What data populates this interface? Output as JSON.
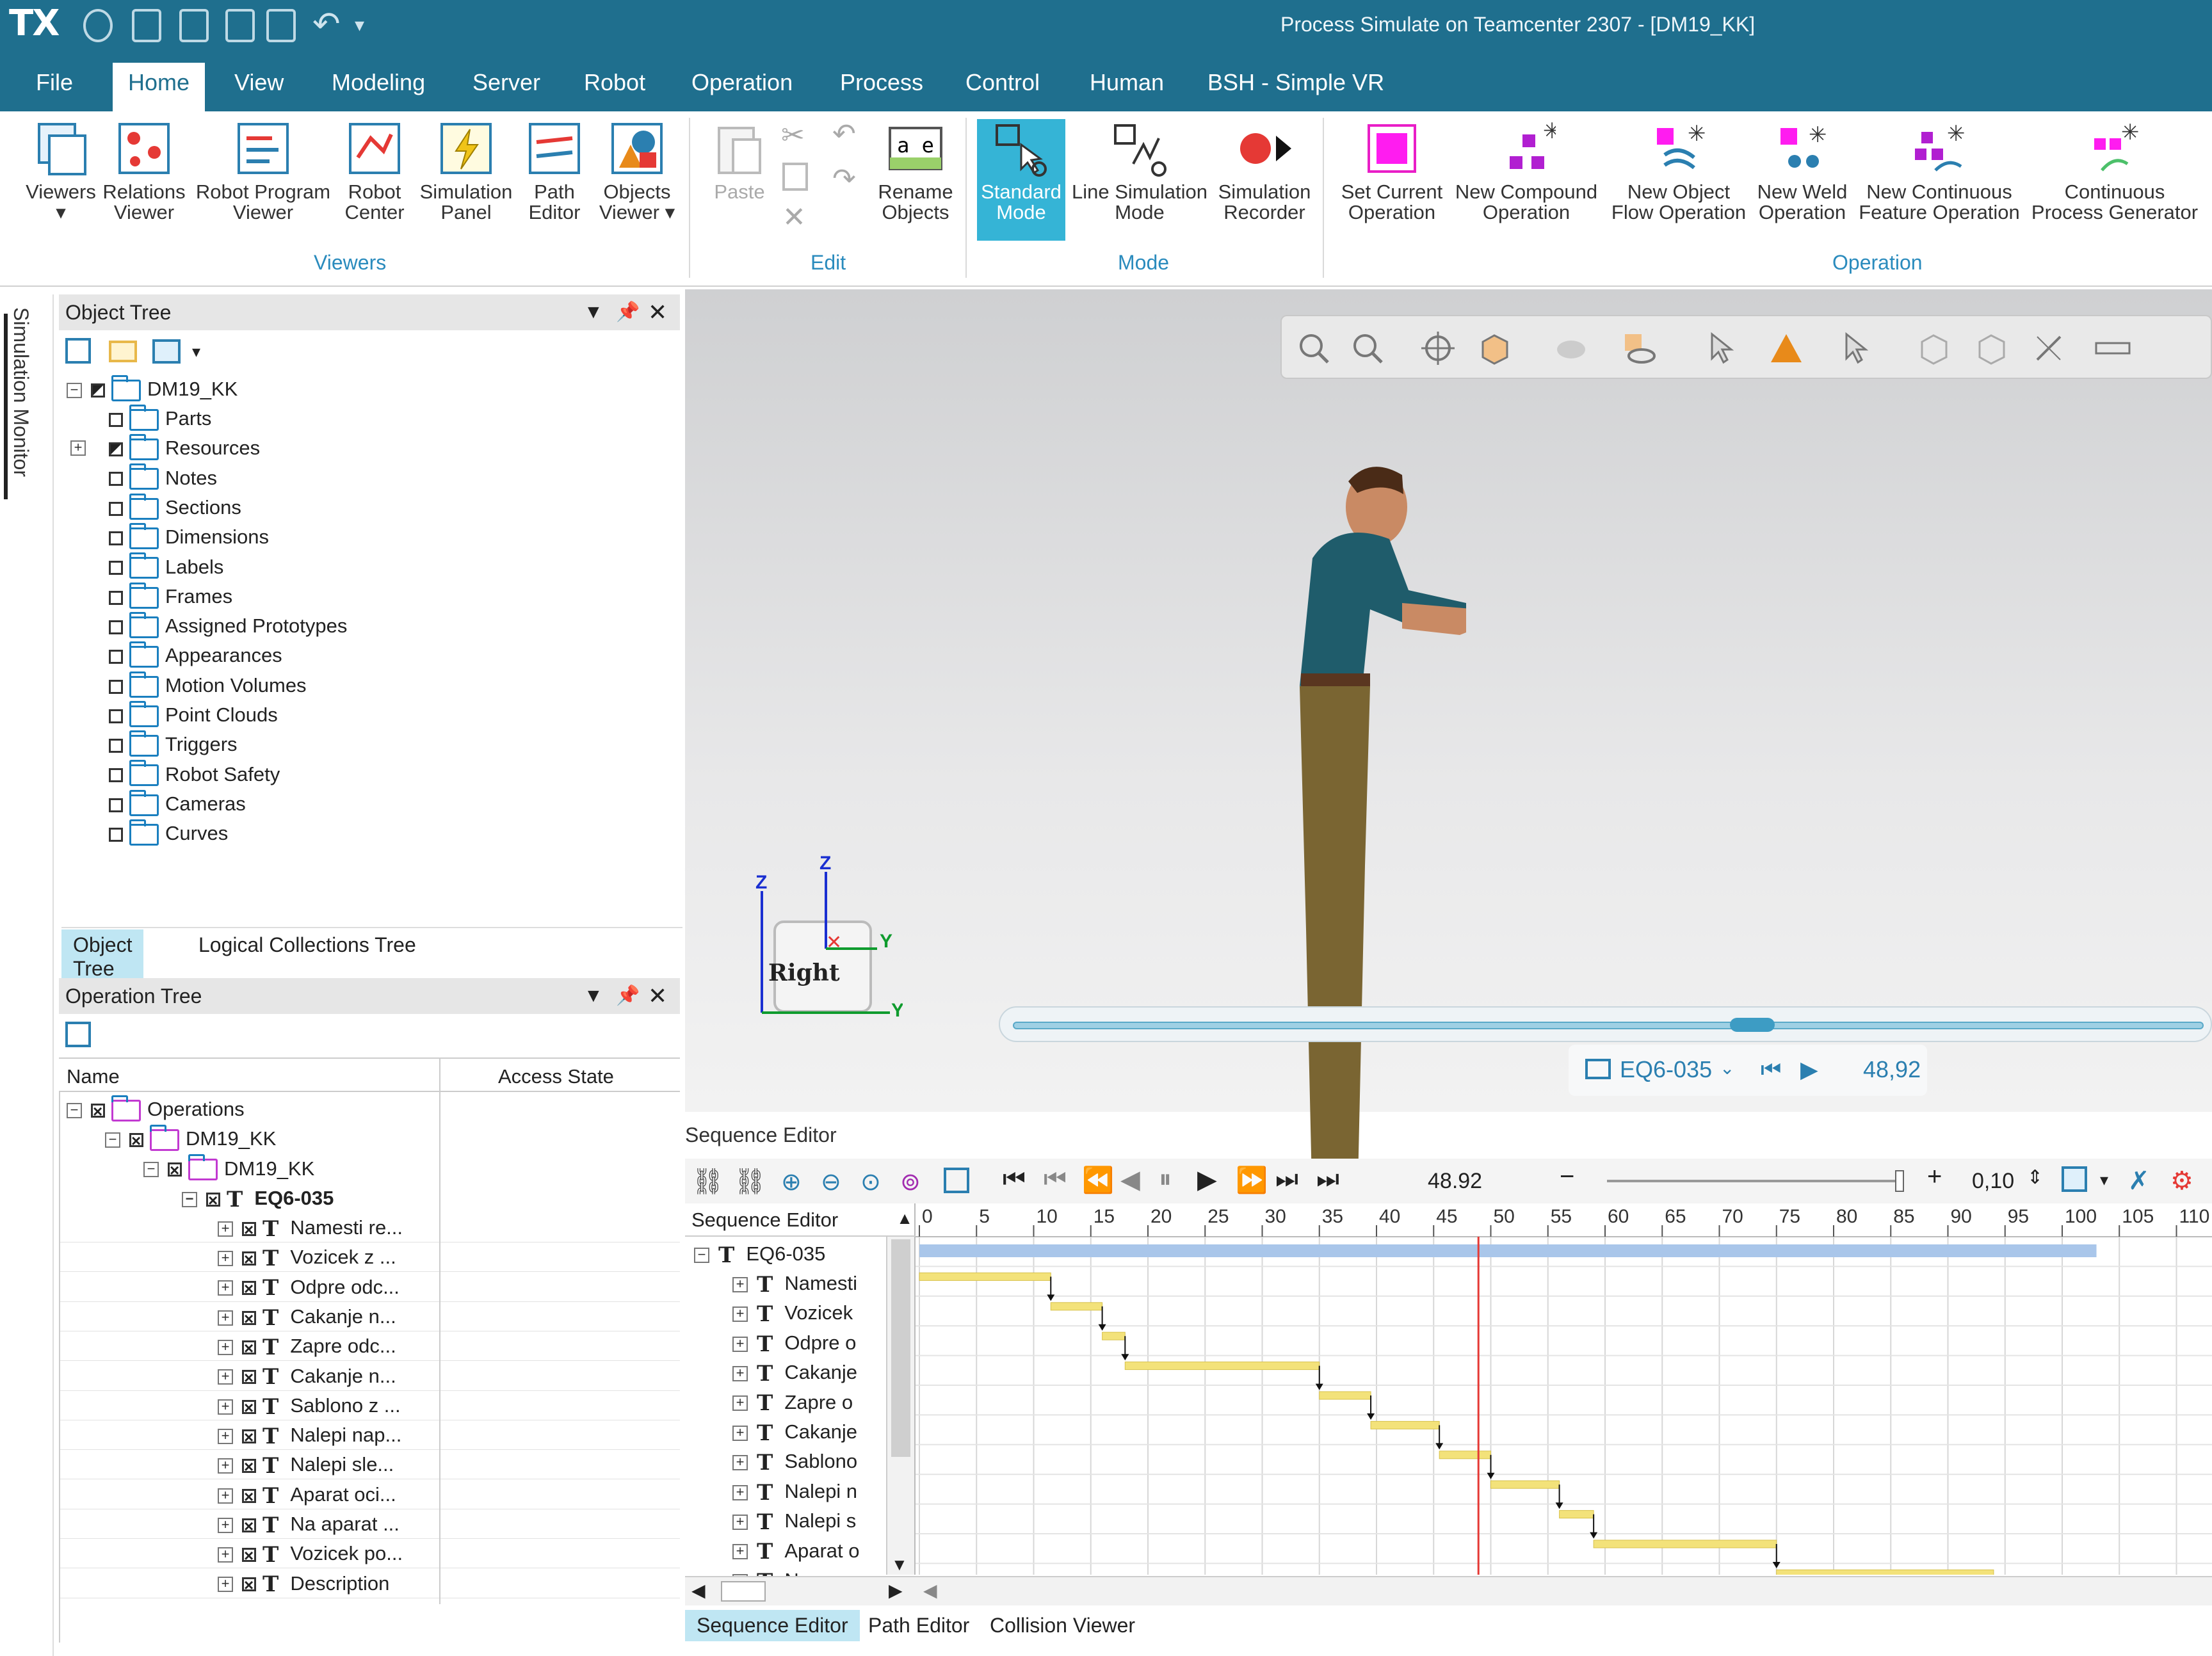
{
  "titlebar": {
    "logo": "TX",
    "title": "Process Simulate on Teamcenter 2307 - [DM19_KK]"
  },
  "menu": [
    "File",
    "Home",
    "View",
    "Modeling",
    "Server",
    "Robot",
    "Operation",
    "Process",
    "Control",
    "Human",
    "BSH - Simple VR"
  ],
  "ribbon": {
    "viewers": [
      {
        "l1": "Viewers",
        "l2": "▾"
      },
      {
        "l1": "Relations",
        "l2": "Viewer"
      },
      {
        "l1": "Robot Program",
        "l2": "Viewer"
      },
      {
        "l1": "Robot",
        "l2": "Center"
      },
      {
        "l1": "Simulation",
        "l2": "Panel"
      },
      {
        "l1": "Path",
        "l2": "Editor"
      },
      {
        "l1": "Objects",
        "l2": "Viewer ▾"
      }
    ],
    "edit": [
      {
        "l1": "Paste",
        "l2": ""
      },
      {
        "l1": "Rename",
        "l2": "Objects"
      }
    ],
    "mode": [
      {
        "l1": "Standard",
        "l2": "Mode"
      },
      {
        "l1": "Line Simulation",
        "l2": "Mode"
      },
      {
        "l1": "Simulation",
        "l2": "Recorder"
      }
    ],
    "operation": [
      {
        "l1": "Set Current",
        "l2": "Operation"
      },
      {
        "l1": "New Compound",
        "l2": "Operation"
      },
      {
        "l1": "New Object",
        "l2": "Flow Operation"
      },
      {
        "l1": "New Weld",
        "l2": "Operation"
      },
      {
        "l1": "New Continuous",
        "l2": "Feature Operation"
      },
      {
        "l1": "Continuous",
        "l2": "Process Generator"
      }
    ],
    "groups": {
      "viewers": "Viewers",
      "edit": "Edit",
      "mode": "Mode",
      "operation": "Operation"
    },
    "rename_icon_text": "a e"
  },
  "sidebar": {
    "label": "Simulation Monitor"
  },
  "object_tree": {
    "title": "Object Tree",
    "root": "DM19_KK",
    "items": [
      "Parts",
      "Resources",
      "Notes",
      "Sections",
      "Dimensions",
      "Labels",
      "Frames",
      "Assigned Prototypes",
      "Appearances",
      "Motion Volumes",
      "Point Clouds",
      "Triggers",
      "Robot Safety",
      "Cameras",
      "Curves"
    ],
    "tabs": [
      "Object Tree",
      "Logical Collections Tree"
    ]
  },
  "operation_tree": {
    "title": "Operation Tree",
    "col_name": "Name",
    "col_access": "Access State",
    "rows": [
      {
        "label": "Operations",
        "level": 0
      },
      {
        "label": "DM19_KK",
        "level": 1
      },
      {
        "label": "DM19_KK",
        "level": 2
      },
      {
        "label": "EQ6-035",
        "level": 3
      }
    ],
    "ops": [
      "Namesti re...",
      "Vozicek z ...",
      "Odpre odc...",
      "Cakanje n...",
      "Zapre odc...",
      "Cakanje n...",
      "Sablono z ...",
      "Nalepi nap...",
      "Nalepi sle...",
      "Aparat oci...",
      "Na aparat ...",
      "Vozicek po...",
      "Description"
    ]
  },
  "viewport": {
    "cube_label": "Right",
    "axis_z": "Z",
    "axis_y": "Y",
    "sim_op": "EQ6-035",
    "sim_time": "48,92"
  },
  "sequence_editor": {
    "title": "Sequence Editor",
    "time_value": "48.92",
    "step_value": "0,10",
    "col_header": "Sequence Editor",
    "root": "EQ6-035",
    "ops": [
      "Namesti",
      "Vozicek",
      "Odpre o",
      "Cakanje",
      "Zapre o",
      "Cakanje",
      "Sablono",
      "Nalepi n",
      "Nalepi s",
      "Aparat o",
      "N..."
    ],
    "ticks": [
      0,
      5,
      10,
      15,
      20,
      25,
      30,
      35,
      40,
      45,
      50,
      55,
      60,
      65,
      70,
      75,
      80,
      85,
      90,
      95,
      100,
      105,
      110
    ],
    "tick_labels": [
      "0",
      "5",
      "10",
      "15",
      "20",
      "25",
      "30",
      "35",
      "40",
      "45",
      "50",
      "55",
      "60",
      "65",
      "70",
      "75",
      "80",
      "85",
      "90",
      "95",
      "100",
      "105",
      "110"
    ],
    "current_time": 48.92,
    "bars": [
      {
        "start": 0,
        "end": 11.5
      },
      {
        "start": 11.5,
        "end": 16
      },
      {
        "start": 16,
        "end": 18
      },
      {
        "start": 18,
        "end": 35
      },
      {
        "start": 35,
        "end": 39.5
      },
      {
        "start": 39.5,
        "end": 45.5
      },
      {
        "start": 45.5,
        "end": 50
      },
      {
        "start": 50,
        "end": 56
      },
      {
        "start": 56,
        "end": 59
      },
      {
        "start": 59,
        "end": 75
      },
      {
        "start": 75,
        "end": 94
      }
    ],
    "summary": {
      "start": 0,
      "end": 103
    },
    "colors": {
      "bar": "#f3e27a",
      "summary": "#a9c6ea",
      "cursor": "#e53935"
    },
    "bottom_tabs": [
      "Sequence Editor",
      "Path Editor",
      "Collision Viewer"
    ]
  }
}
